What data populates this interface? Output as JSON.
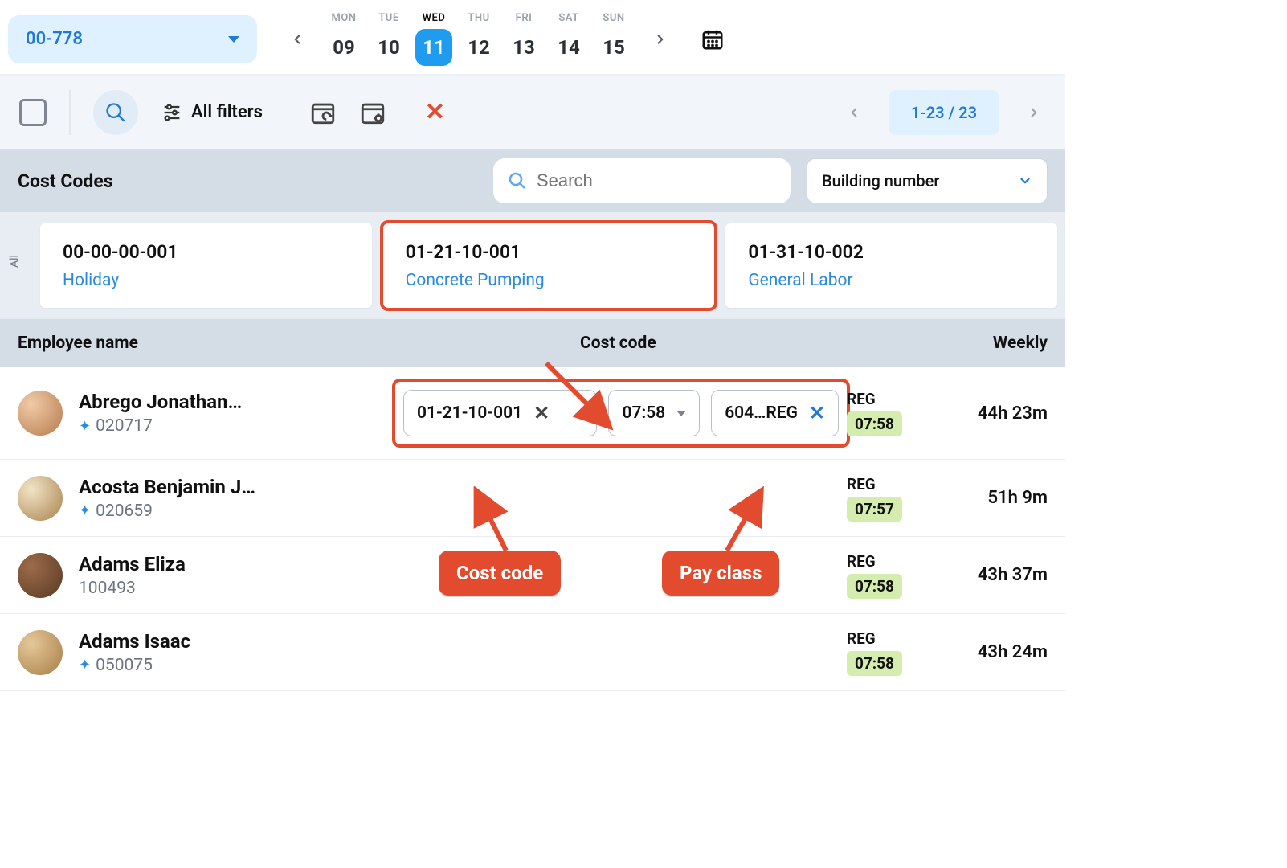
{
  "project": {
    "code": "00-778"
  },
  "week": {
    "days": [
      {
        "dow": "MON",
        "num": "09",
        "active": false
      },
      {
        "dow": "TUE",
        "num": "10",
        "active": false
      },
      {
        "dow": "WED",
        "num": "11",
        "active": true
      },
      {
        "dow": "THU",
        "num": "12",
        "active": false
      },
      {
        "dow": "FRI",
        "num": "13",
        "active": false
      },
      {
        "dow": "SAT",
        "num": "14",
        "active": false
      },
      {
        "dow": "SUN",
        "num": "15",
        "active": false
      }
    ]
  },
  "toolbar": {
    "filters_label": "All filters",
    "pager_label": "1-23 / 23"
  },
  "cost_codes": {
    "title": "Cost Codes",
    "search_placeholder": "Search",
    "group_by_label": "Building number",
    "all_label": "All",
    "cards": [
      {
        "code": "00-00-00-001",
        "label": "Holiday",
        "highlight": false
      },
      {
        "code": "01-21-10-001",
        "label": "Concrete Pumping",
        "highlight": true
      },
      {
        "code": "01-31-10-002",
        "label": "General Labor",
        "highlight": false
      }
    ]
  },
  "table": {
    "headers": {
      "name": "Employee name",
      "cost": "Cost code",
      "weekly": "Weekly"
    }
  },
  "employees": [
    {
      "name": "Abrego Jonathan…",
      "badge": "020717",
      "starred": true,
      "slots": {
        "code": "01-21-10-001",
        "time": "07:58",
        "pay": "604…REG"
      },
      "reg_label": "REG",
      "reg_time": "07:58",
      "weekly": "44h 23m"
    },
    {
      "name": "Acosta Benjamin J…",
      "badge": "020659",
      "starred": true,
      "reg_label": "REG",
      "reg_time": "07:57",
      "weekly": "51h 9m"
    },
    {
      "name": "Adams Eliza",
      "badge": "100493",
      "starred": false,
      "reg_label": "REG",
      "reg_time": "07:58",
      "weekly": "43h 37m"
    },
    {
      "name": "Adams Isaac",
      "badge": "050075",
      "starred": true,
      "reg_label": "REG",
      "reg_time": "07:58",
      "weekly": "43h 24m"
    }
  ],
  "annotations": {
    "cost_code_label": "Cost code",
    "pay_class_label": "Pay class"
  }
}
